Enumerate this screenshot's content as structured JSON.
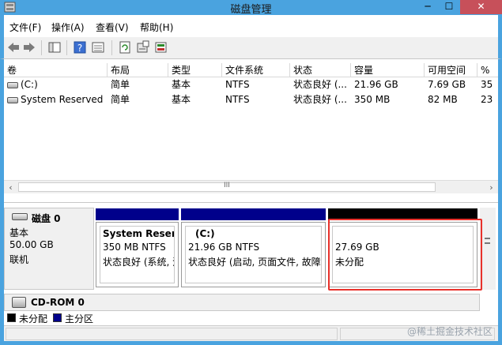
{
  "window": {
    "title": "磁盘管理",
    "min_label": "─",
    "max_label": "☐",
    "close_label": "✕"
  },
  "menu": [
    "文件(F)",
    "操作(A)",
    "查看(V)",
    "帮助(H)"
  ],
  "toolbar_icons": [
    "back-icon",
    "forward-icon",
    "console-tree-icon",
    "help-icon",
    "properties-list-icon",
    "refresh-icon",
    "properties-icon",
    "disk-settings-icon"
  ],
  "volume_list": {
    "columns": [
      "卷",
      "布局",
      "类型",
      "文件系统",
      "状态",
      "容量",
      "可用空间",
      "%"
    ],
    "rows": [
      {
        "volume": "(C:)",
        "layout": "简单",
        "type": "基本",
        "fs": "NTFS",
        "status": "状态良好 (...",
        "capacity": "21.96 GB",
        "free": "7.69 GB",
        "pct": "35"
      },
      {
        "volume": "System Reserved",
        "layout": "简单",
        "type": "基本",
        "fs": "NTFS",
        "status": "状态良好 (...",
        "capacity": "350 MB",
        "free": "82 MB",
        "pct": "23"
      }
    ],
    "scroll_grip": "III"
  },
  "disk0": {
    "name": "磁盘 0",
    "kind": "基本",
    "size": "50.00 GB",
    "state": "联机",
    "partitions": [
      {
        "name": "System Reserve",
        "size": "350 MB NTFS",
        "status": "状态良好 (系统, 活",
        "bar_color": "#00008b"
      },
      {
        "name": "(C:)",
        "size": "21.96 GB NTFS",
        "status": "状态良好 (启动, 页面文件, 故障转",
        "bar_color": "#00008b"
      },
      {
        "name": "",
        "size": "27.69 GB",
        "status": "未分配",
        "bar_color": "#000000"
      }
    ]
  },
  "cdrom": {
    "name": "CD-ROM 0"
  },
  "legend": [
    {
      "label": "未分配",
      "color": "#000000"
    },
    {
      "label": "主分区",
      "color": "#00008b"
    }
  ],
  "watermark": "@稀土掘金技术社区"
}
